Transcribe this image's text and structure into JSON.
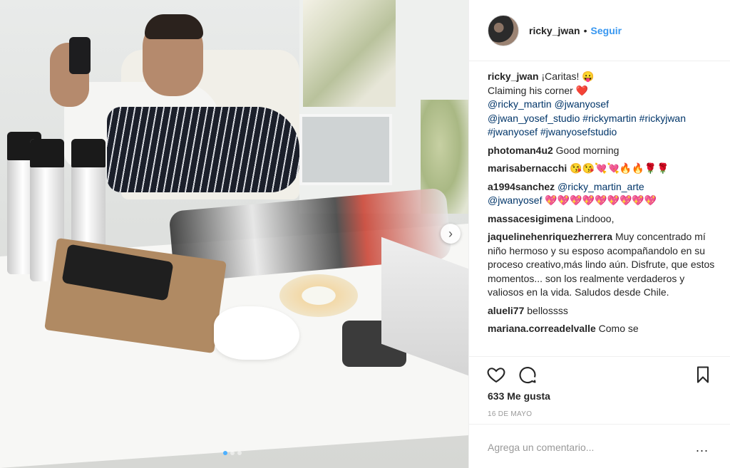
{
  "post": {
    "username": "ricky_jwan",
    "follow_sep": "•",
    "follow_label": "Seguir",
    "carousel": {
      "current": 1,
      "total": 3
    }
  },
  "caption": {
    "user": "ricky_jwan",
    "line1": "¡Caritas! 😛",
    "line2": "Claiming his corner",
    "heart": "❤️",
    "mention1": "@ricky_martin",
    "mention2": "@jwanyosef",
    "mention3": "@jwan_yosef_studio",
    "tag1": "#rickymartin",
    "tag2": "#rickyjwan",
    "tag3": "#jwanyosef",
    "tag4": "#jwanyosefstudio"
  },
  "comments": [
    {
      "user": "photoman4u2",
      "text": "Good morning"
    },
    {
      "user": "marisabernacchi",
      "text": "😘😘💘💘🔥🔥🌹🌹"
    },
    {
      "user": "a1994sanchez",
      "mention1": "@ricky_martin_arte",
      "mention2": "@jwanyosef",
      "text": "💖💖💖💖💖💖💖💖💖"
    },
    {
      "user": "massacesigimena",
      "text": "Lindooo,"
    },
    {
      "user": "jaquelinehenriquezherrera",
      "text": "Muy concentrado mí niño hermoso y su esposo acompañandolo en su proceso creativo,más lindo aún. Disfrute, que estos momentos... son los realmente verdaderos y valiosos en la vida. Saludos desde Chile."
    },
    {
      "user": "alueli77",
      "text": "bellossss"
    },
    {
      "user": "mariana.correadelvalle",
      "text": "Como se"
    }
  ],
  "stats": {
    "likes": "633 Me gusta",
    "date": "16 DE MAYO"
  },
  "comment_input": {
    "placeholder": "Agrega un comentario...",
    "more": "..."
  },
  "icons": {
    "like": "heart-outline-icon",
    "comment": "speech-bubble-icon",
    "save": "bookmark-icon",
    "next": "chevron-right-icon"
  },
  "colors": {
    "link": "#003569",
    "follow": "#3897f0",
    "muted": "#999999",
    "border": "#efefef",
    "active_dot": "#4db0ff"
  }
}
